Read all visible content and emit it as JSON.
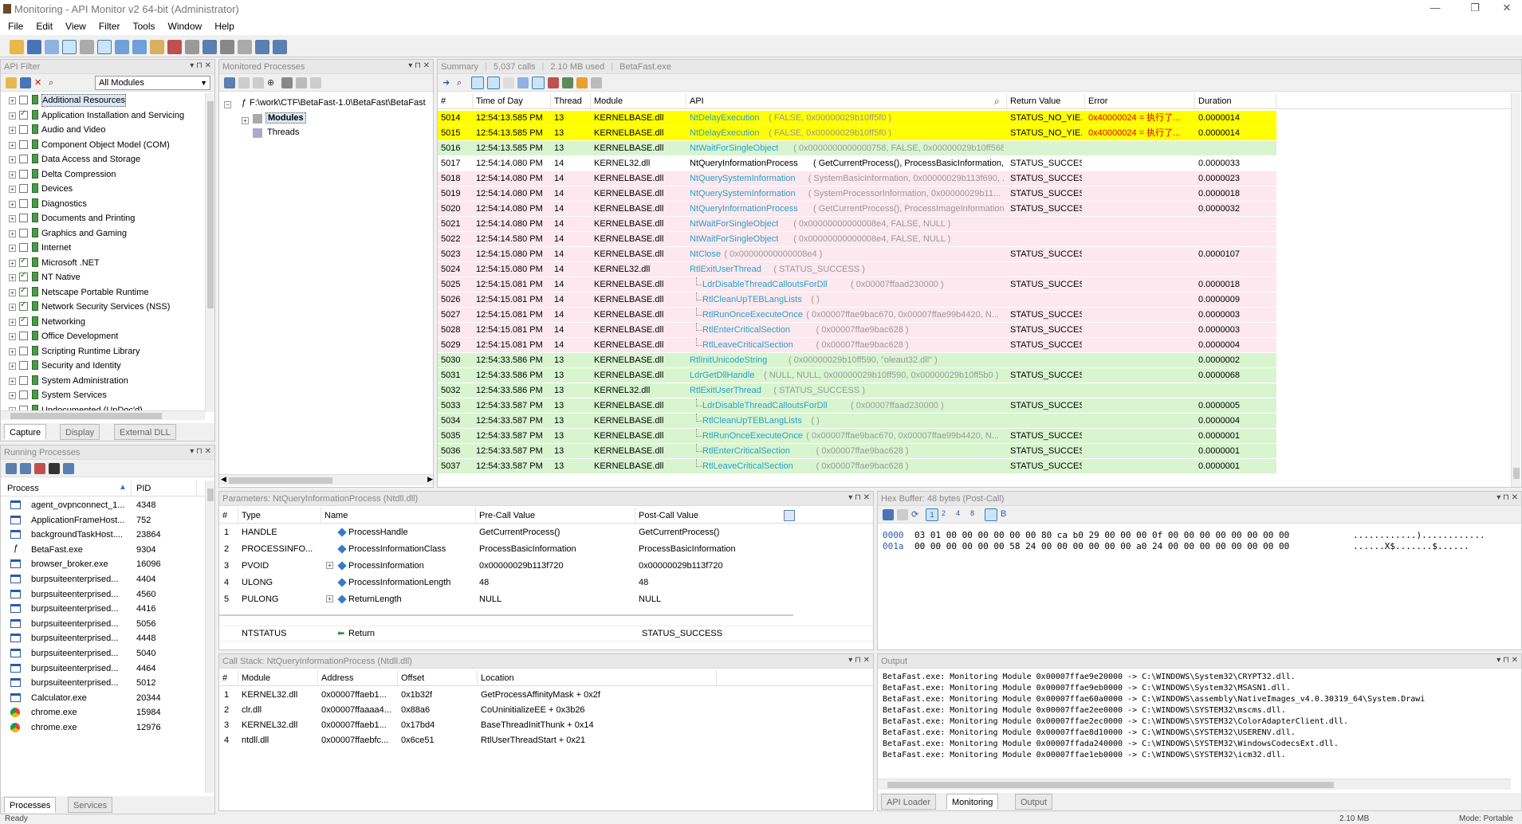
{
  "window": {
    "title": "Monitoring - API Monitor v2 64-bit (Administrator)"
  },
  "menu": [
    "File",
    "Edit",
    "View",
    "Filter",
    "Tools",
    "Window",
    "Help"
  ],
  "api_filter": {
    "title": "API Filter",
    "module_select": "All Modules",
    "items": [
      {
        "label": "Additional Resources",
        "checked": false
      },
      {
        "label": "Application Installation and Servicing",
        "checked": true
      },
      {
        "label": "Audio and Video",
        "checked": false
      },
      {
        "label": "Component Object Model (COM)",
        "checked": false
      },
      {
        "label": "Data Access and Storage",
        "checked": false
      },
      {
        "label": "Delta Compression",
        "checked": false
      },
      {
        "label": "Devices",
        "checked": false
      },
      {
        "label": "Diagnostics",
        "checked": false
      },
      {
        "label": "Documents and Printing",
        "checked": false
      },
      {
        "label": "Graphics and Gaming",
        "checked": false
      },
      {
        "label": "Internet",
        "checked": false
      },
      {
        "label": "Microsoft .NET",
        "checked": true
      },
      {
        "label": "NT Native",
        "checked": true
      },
      {
        "label": "Netscape Portable Runtime",
        "checked": true
      },
      {
        "label": "Network Security Services (NSS)",
        "checked": true
      },
      {
        "label": "Networking",
        "checked": true
      },
      {
        "label": "Office Development",
        "checked": false
      },
      {
        "label": "Scripting Runtime Library",
        "checked": false
      },
      {
        "label": "Security and Identity",
        "checked": false
      },
      {
        "label": "System Administration",
        "checked": false
      },
      {
        "label": "System Services",
        "checked": false
      },
      {
        "label": "Undocumented (UnDoc'd)",
        "checked": false
      }
    ],
    "tabs": [
      "Capture",
      "Display",
      "External DLL"
    ]
  },
  "running": {
    "title": "Running Processes",
    "col_process": "Process",
    "col_pid": "PID",
    "items": [
      {
        "name": "agent_ovpnconnect_1...",
        "pid": "4348"
      },
      {
        "name": "ApplicationFrameHost...",
        "pid": "752"
      },
      {
        "name": "backgroundTaskHost....",
        "pid": "23864"
      },
      {
        "name": "BetaFast.exe",
        "pid": "9304"
      },
      {
        "name": "browser_broker.exe",
        "pid": "16096"
      },
      {
        "name": "burpsuiteenterprised...",
        "pid": "4404"
      },
      {
        "name": "burpsuiteenterprised...",
        "pid": "4560"
      },
      {
        "name": "burpsuiteenterprised...",
        "pid": "4416"
      },
      {
        "name": "burpsuiteenterprised...",
        "pid": "5056"
      },
      {
        "name": "burpsuiteenterprised...",
        "pid": "4448"
      },
      {
        "name": "burpsuiteenterprised...",
        "pid": "5040"
      },
      {
        "name": "burpsuiteenterprised...",
        "pid": "4464"
      },
      {
        "name": "burpsuiteenterprised...",
        "pid": "5012"
      },
      {
        "name": "Calculator.exe",
        "pid": "20344"
      },
      {
        "name": "chrome.exe",
        "pid": "15984"
      },
      {
        "name": "chrome.exe",
        "pid": "12976"
      }
    ],
    "tabs": [
      "Processes",
      "Services"
    ]
  },
  "monitored": {
    "title": "Monitored Processes",
    "path": "F:\\work\\CTF\\BetaFast-1.0\\BetaFast\\BetaFast",
    "children": [
      "Modules",
      "Threads"
    ]
  },
  "summary": {
    "title": "Summary",
    "calls": "5,037 calls",
    "mem": "2.10 MB used",
    "exe": "BetaFast.exe",
    "cols": [
      "#",
      "Time of Day",
      "Thread",
      "Module",
      "API",
      "Return Value",
      "Error",
      "Duration"
    ],
    "rows": [
      {
        "n": "5014",
        "t": "12:54:13.585 PM",
        "th": "13",
        "m": "KERNELBASE.dll",
        "fn": "NtDelayExecution",
        "args": " ( FALSE, 0x00000029b10ff5f0 )",
        "rv": "STATUS_NO_YIE...",
        "err": "0x40000024 = 执行了...",
        "d": "0.0000014",
        "bg": "#ffff00",
        "ind": 0
      },
      {
        "n": "5015",
        "t": "12:54:13.585 PM",
        "th": "13",
        "m": "KERNELBASE.dll",
        "fn": "NtDelayExecution",
        "args": " ( FALSE, 0x00000029b10ff5f0 )",
        "rv": "STATUS_NO_YIE...",
        "err": "0x40000024 = 执行了...",
        "d": "0.0000014",
        "bg": "#ffff00",
        "ind": 0
      },
      {
        "n": "5016",
        "t": "12:54:13.585 PM",
        "th": "13",
        "m": "KERNELBASE.dll",
        "fn": "NtWaitForSingleObject",
        "args": " ( 0x0000000000000758, FALSE, 0x00000029b10ff568 )",
        "rv": "",
        "err": "",
        "d": "",
        "bg": "#d8f5d0",
        "ind": 0
      },
      {
        "n": "5017",
        "t": "12:54:14.080 PM",
        "th": "14",
        "m": "KERNEL32.dll",
        "fn": "NtQueryInformationProcess",
        "args": " ( GetCurrentProcess(), ProcessBasicInformation, ...",
        "rv": "STATUS_SUCCESS",
        "err": "",
        "d": "0.0000033",
        "bg": "#ffffff",
        "ind": 0,
        "bold": true
      },
      {
        "n": "5018",
        "t": "12:54:14.080 PM",
        "th": "14",
        "m": "KERNELBASE.dll",
        "fn": "NtQuerySystemInformation",
        "args": " ( SystemBasicInformation, 0x00000029b113f690, ...",
        "rv": "STATUS_SUCCESS",
        "err": "",
        "d": "0.0000023",
        "bg": "#fce8ee",
        "ind": 0
      },
      {
        "n": "5019",
        "t": "12:54:14.080 PM",
        "th": "14",
        "m": "KERNELBASE.dll",
        "fn": "NtQuerySystemInformation",
        "args": " ( SystemProcessorInformation, 0x00000029b11...",
        "rv": "STATUS_SUCCESS",
        "err": "",
        "d": "0.0000018",
        "bg": "#fce8ee",
        "ind": 0
      },
      {
        "n": "5020",
        "t": "12:54:14.080 PM",
        "th": "14",
        "m": "KERNELBASE.dll",
        "fn": "NtQueryInformationProcess",
        "args": " ( GetCurrentProcess(), ProcessImageInformation, ...",
        "rv": "STATUS_SUCCESS",
        "err": "",
        "d": "0.0000032",
        "bg": "#fce8ee",
        "ind": 0
      },
      {
        "n": "5021",
        "t": "12:54:14.080 PM",
        "th": "14",
        "m": "KERNELBASE.dll",
        "fn": "NtWaitForSingleObject",
        "args": " ( 0x00000000000008e4, FALSE, NULL )",
        "rv": "",
        "err": "",
        "d": "",
        "bg": "#fce8ee",
        "ind": 0
      },
      {
        "n": "5022",
        "t": "12:54:14.580 PM",
        "th": "14",
        "m": "KERNELBASE.dll",
        "fn": "NtWaitForSingleObject",
        "args": " ( 0x00000000000008e4, FALSE, NULL )",
        "rv": "",
        "err": "",
        "d": "",
        "bg": "#fce8ee",
        "ind": 0
      },
      {
        "n": "5023",
        "t": "12:54:15.080 PM",
        "th": "14",
        "m": "KERNELBASE.dll",
        "fn": "NtClose",
        "args": " ( 0x00000000000008e4 )",
        "rv": "STATUS_SUCCESS",
        "err": "",
        "d": "0.0000107",
        "bg": "#fce8ee",
        "ind": 0
      },
      {
        "n": "5024",
        "t": "12:54:15.080 PM",
        "th": "14",
        "m": "KERNEL32.dll",
        "fn": "RtlExitUserThread",
        "args": " ( STATUS_SUCCESS )",
        "rv": "",
        "err": "",
        "d": "",
        "bg": "#fce8ee",
        "ind": 0
      },
      {
        "n": "5025",
        "t": "12:54:15.081 PM",
        "th": "14",
        "m": "KERNELBASE.dll",
        "fn": "LdrDisableThreadCalloutsForDll",
        "args": " ( 0x00007ffaad230000 )",
        "rv": "STATUS_SUCCESS",
        "err": "",
        "d": "0.0000018",
        "bg": "#fce8ee",
        "ind": 1
      },
      {
        "n": "5026",
        "t": "12:54:15.081 PM",
        "th": "14",
        "m": "KERNELBASE.dll",
        "fn": "RtlCleanUpTEBLangLists",
        "args": " ( )",
        "rv": "",
        "err": "",
        "d": "0.0000009",
        "bg": "#fce8ee",
        "ind": 1
      },
      {
        "n": "5027",
        "t": "12:54:15.081 PM",
        "th": "14",
        "m": "KERNELBASE.dll",
        "fn": "RtlRunOnceExecuteOnce",
        "args": " ( 0x00007ffae9bac670, 0x00007ffae99b4420, N...",
        "rv": "STATUS_SUCCESS",
        "err": "",
        "d": "0.0000003",
        "bg": "#fce8ee",
        "ind": 1
      },
      {
        "n": "5028",
        "t": "12:54:15.081 PM",
        "th": "14",
        "m": "KERNELBASE.dll",
        "fn": "RtlEnterCriticalSection",
        "args": " ( 0x00007ffae9bac628 )",
        "rv": "STATUS_SUCCESS",
        "err": "",
        "d": "0.0000003",
        "bg": "#fce8ee",
        "ind": 1
      },
      {
        "n": "5029",
        "t": "12:54:15.081 PM",
        "th": "14",
        "m": "KERNELBASE.dll",
        "fn": "RtlLeaveCriticalSection",
        "args": " ( 0x00007ffae9bac628 )",
        "rv": "STATUS_SUCCESS",
        "err": "",
        "d": "0.0000004",
        "bg": "#fce8ee",
        "ind": 1
      },
      {
        "n": "5030",
        "t": "12:54:33.586 PM",
        "th": "13",
        "m": "KERNELBASE.dll",
        "fn": "RtlInitUnicodeString",
        "args": " ( 0x00000029b10ff590, \"oleaut32.dll\" )",
        "rv": "",
        "err": "",
        "d": "0.0000002",
        "bg": "#d8f5d0",
        "ind": 0
      },
      {
        "n": "5031",
        "t": "12:54:33.586 PM",
        "th": "13",
        "m": "KERNELBASE.dll",
        "fn": "LdrGetDllHandle",
        "args": " ( NULL, NULL, 0x00000029b10ff590, 0x00000029b10ff5b0 )",
        "rv": "STATUS_SUCCESS",
        "err": "",
        "d": "0.0000068",
        "bg": "#d8f5d0",
        "ind": 0
      },
      {
        "n": "5032",
        "t": "12:54:33.586 PM",
        "th": "13",
        "m": "KERNEL32.dll",
        "fn": "RtlExitUserThread",
        "args": " ( STATUS_SUCCESS )",
        "rv": "",
        "err": "",
        "d": "",
        "bg": "#d8f5d0",
        "ind": 0
      },
      {
        "n": "5033",
        "t": "12:54:33.587 PM",
        "th": "13",
        "m": "KERNELBASE.dll",
        "fn": "LdrDisableThreadCalloutsForDll",
        "args": " ( 0x00007ffaad230000 )",
        "rv": "STATUS_SUCCESS",
        "err": "",
        "d": "0.0000005",
        "bg": "#d8f5d0",
        "ind": 1
      },
      {
        "n": "5034",
        "t": "12:54:33.587 PM",
        "th": "13",
        "m": "KERNELBASE.dll",
        "fn": "RtlCleanUpTEBLangLists",
        "args": " ( )",
        "rv": "",
        "err": "",
        "d": "0.0000004",
        "bg": "#d8f5d0",
        "ind": 1
      },
      {
        "n": "5035",
        "t": "12:54:33.587 PM",
        "th": "13",
        "m": "KERNELBASE.dll",
        "fn": "RtlRunOnceExecuteOnce",
        "args": " ( 0x00007ffae9bac670, 0x00007ffae99b4420, N...",
        "rv": "STATUS_SUCCESS",
        "err": "",
        "d": "0.0000001",
        "bg": "#d8f5d0",
        "ind": 1
      },
      {
        "n": "5036",
        "t": "12:54:33.587 PM",
        "th": "13",
        "m": "KERNELBASE.dll",
        "fn": "RtlEnterCriticalSection",
        "args": " ( 0x00007ffae9bac628 )",
        "rv": "STATUS_SUCCESS",
        "err": "",
        "d": "0.0000001",
        "bg": "#d8f5d0",
        "ind": 1
      },
      {
        "n": "5037",
        "t": "12:54:33.587 PM",
        "th": "13",
        "m": "KERNELBASE.dll",
        "fn": "RtlLeaveCriticalSection",
        "args": " ( 0x00007ffae9bac628 )",
        "rv": "STATUS_SUCCESS",
        "err": "",
        "d": "0.0000001",
        "bg": "#d8f5d0",
        "ind": 1
      }
    ]
  },
  "params": {
    "title": "Parameters: NtQueryInformationProcess (Ntdll.dll)",
    "cols": [
      "#",
      "Type",
      "Name",
      "Pre-Call Value",
      "Post-Call Value"
    ],
    "rows": [
      {
        "n": "1",
        "type": "HANDLE",
        "name": "ProcessHandle",
        "pre": "GetCurrentProcess()",
        "post": "GetCurrentProcess()"
      },
      {
        "n": "2",
        "type": "PROCESSINFO...",
        "name": "ProcessInformationClass",
        "pre": "ProcessBasicInformation",
        "post": "ProcessBasicInformation"
      },
      {
        "n": "3",
        "type": "PVOID",
        "name": "ProcessInformation",
        "pre": "0x00000029b113f720",
        "post": "0x00000029b113f720"
      },
      {
        "n": "4",
        "type": "ULONG",
        "name": "ProcessInformationLength",
        "pre": "48",
        "post": "48"
      },
      {
        "n": "5",
        "type": "PULONG",
        "name": "ReturnLength",
        "pre": "NULL",
        "post": "NULL"
      }
    ],
    "ret": {
      "type": "NTSTATUS",
      "name": "Return",
      "post": "STATUS_SUCCESS"
    }
  },
  "hex": {
    "title": "Hex Buffer: 48 bytes (Post-Call)",
    "lines": [
      {
        "addr": "0000",
        "bytes": "03 01 00 00 00 00 00 00 80 ca b0 29 00 00 00 0f 00 00 00 00 00 00 00 00",
        "ascii": "............)............"
      },
      {
        "addr": "001a",
        "bytes": "00 00 00 00 00 00 58 24 00 00 00 00 00 00 a0 24 00 00 00 00 00 00 00 00",
        "ascii": "......X$.......$......"
      }
    ]
  },
  "callstack": {
    "title": "Call Stack: NtQueryInformationProcess (Ntdll.dll)",
    "cols": [
      "#",
      "Module",
      "Address",
      "Offset",
      "Location"
    ],
    "rows": [
      {
        "n": "1",
        "mod": "KERNEL32.dll",
        "addr": "0x00007ffaeb1...",
        "off": "0x1b32f",
        "loc": "GetProcessAffinityMask + 0x2f"
      },
      {
        "n": "2",
        "mod": "clr.dll",
        "addr": "0x00007ffaaaa4...",
        "off": "0x88a6",
        "loc": "CoUninitializeEE + 0x3b26"
      },
      {
        "n": "3",
        "mod": "KERNEL32.dll",
        "addr": "0x00007ffaeb1...",
        "off": "0x17bd4",
        "loc": "BaseThreadInitThunk + 0x14"
      },
      {
        "n": "4",
        "mod": "ntdll.dll",
        "addr": "0x00007ffaebfc...",
        "off": "0x6ce51",
        "loc": "RtlUserThreadStart + 0x21"
      }
    ]
  },
  "output": {
    "title": "Output",
    "lines": [
      "BetaFast.exe: Monitoring Module 0x00007ffae9e20000 -> C:\\WINDOWS\\System32\\CRYPT32.dll.",
      "BetaFast.exe: Monitoring Module 0x00007ffae9eb0000 -> C:\\WINDOWS\\System32\\MSASN1.dll.",
      "BetaFast.exe: Monitoring Module 0x00007ffae60a0000 -> C:\\WINDOWS\\assembly\\NativeImages_v4.0.30319_64\\System.Drawi",
      "BetaFast.exe: Monitoring Module 0x00007ffae2ee0000 -> C:\\WINDOWS\\SYSTEM32\\mscms.dll.",
      "BetaFast.exe: Monitoring Module 0x00007ffae2ec0000 -> C:\\WINDOWS\\SYSTEM32\\ColorAdapterClient.dll.",
      "BetaFast.exe: Monitoring Module 0x00007ffae8d10000 -> C:\\WINDOWS\\SYSTEM32\\USERENV.dll.",
      "BetaFast.exe: Monitoring Module 0x00007ffada240000 -> C:\\WINDOWS\\SYSTEM32\\WindowsCodecsExt.dll.",
      "BetaFast.exe: Monitoring Module 0x00007ffae1eb0000 -> C:\\WINDOWS\\SYSTEM32\\icm32.dll."
    ],
    "tabs": [
      "API Loader",
      "Monitoring",
      "Output"
    ]
  },
  "status": {
    "left": "Ready",
    "mem": "2.10 MB",
    "mode": "Mode: Portable"
  }
}
